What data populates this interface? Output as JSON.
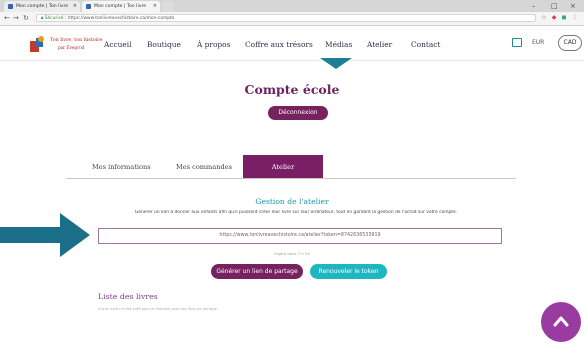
{
  "browser": {
    "tabs": [
      {
        "label": "Mon compte | Ton livre",
        "active": false
      },
      {
        "label": "Mon compte | Ton livre",
        "active": true
      }
    ],
    "url_secure": "Sécurisé",
    "url": "https://www.tonlivreavechistoire.ca/mon-compte"
  },
  "header": {
    "logo_line1": "Ton livre, ton histoire",
    "logo_line2": "par Éveprod",
    "menu": [
      "Accueil",
      "Boutique",
      "À propos",
      "Coffre aux trésors",
      "Médias",
      "Atelier",
      "Contact"
    ],
    "currency": "EUR",
    "account": "CAD"
  },
  "page": {
    "title": "Compte école",
    "logout_label": "Déconnexion"
  },
  "tabs": {
    "info": "Mes informations",
    "orders": "Mes commandes",
    "workshop": "Atelier"
  },
  "workshop": {
    "heading": "Gestion de l'atelier",
    "description": "Générer un lien à donner aux enfants afin qu'il puissent créer leur livre sur leur ordinateur, tout en gardant la gestion de l'achat sur votre compte.",
    "link_value": "https://www.tonlivreavechistoire.ca/atelier?token=8742636533919",
    "expires": "Expire dans 7 h 34",
    "generate_label": "Générer un lien de partage",
    "renew_label": "Renouveler le token"
  },
  "books": {
    "heading": "Liste des livres",
    "empty_text": "Aucun livre n'a été créé pour le moment avec les liens de partage."
  },
  "colors": {
    "purple": "#77215f",
    "teal": "#1eb7c1",
    "arrow": "#1b6f88",
    "fab": "#993ba1"
  }
}
